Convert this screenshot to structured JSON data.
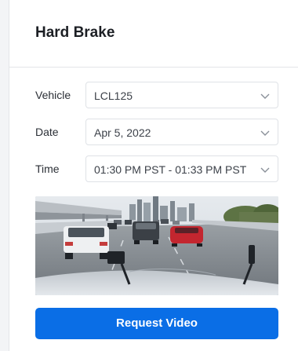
{
  "panel": {
    "title": "Hard Brake"
  },
  "fields": {
    "vehicle": {
      "label": "Vehicle",
      "value": "LCL125",
      "icon": "chevron-down-icon"
    },
    "date": {
      "label": "Date",
      "value": "Apr 5, 2022",
      "icon": "chevron-down-icon"
    },
    "time": {
      "label": "Time",
      "value": "01:30 PM PST - 01:33 PM PST",
      "icon": "chevron-down-icon"
    }
  },
  "actions": {
    "request_label": "Request Video"
  },
  "colors": {
    "accent": "#0a6ee6",
    "border": "#dfe2e6",
    "title": "#1c1f24"
  }
}
